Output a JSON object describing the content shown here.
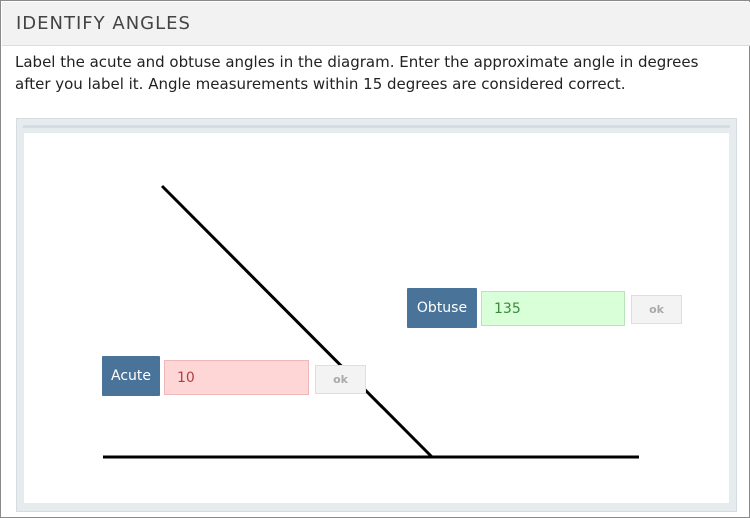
{
  "header": {
    "title": "IDENTIFY ANGLES"
  },
  "instructions": "Label the acute and obtuse angles in the diagram. Enter the approximate angle in degrees after you label it. Angle measurements within 15 degrees are considered correct.",
  "angles": [
    {
      "label": "Obtuse",
      "value": "135",
      "ok_label": "ok",
      "status": "correct"
    },
    {
      "label": "Acute",
      "value": "10",
      "ok_label": "ok",
      "status": "incorrect"
    }
  ],
  "colors": {
    "label_button": "#4a7399",
    "correct_bg": "#d8ffd8",
    "incorrect_bg": "#ffd6d6",
    "line": "#000000"
  }
}
